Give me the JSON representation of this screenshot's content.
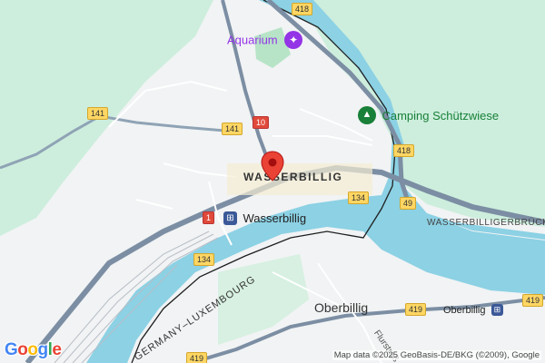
{
  "map": {
    "colors": {
      "land": "#f1f3f4",
      "forest": "#cdeedd",
      "water": "#8cd1e4",
      "border": "#1f1f1f",
      "highway": "#7c8ea3",
      "road": "#ffffff",
      "poi": "#9334e6",
      "park": "#188038",
      "transit": "#3b5998"
    },
    "places": {
      "wasserbillig": "WASSERBILLIG",
      "oberbillig": "Oberbillig",
      "wasserbilliger_bruck": "WASSERBILLIGERBRÜCK",
      "flurstr": "Flurstraß"
    },
    "pois": {
      "aquarium": "Aquarium",
      "camping": "Camping Schützwiese",
      "station_wasserbillig": "Wasserbillig",
      "station_oberbillig": "Oberbillig"
    },
    "border_label": "GERMANY–LUXEMBOURG",
    "route_shields": {
      "r418_top": "418",
      "r141_left": "141",
      "r141_mid": "141",
      "r10": "10",
      "r418_mid": "418",
      "r134": "134",
      "r49": "49",
      "r1": "1",
      "r134_low": "134",
      "r419_mid": "419",
      "r419_right": "419",
      "r419_low": "419"
    },
    "icons": {
      "pin": "location-pin-icon",
      "aquarium": "aquarium-icon",
      "camping": "camping-icon",
      "train": "train-station-icon"
    },
    "attribution": "Map data ©2025 GeoBasis-DE/BKG (©2009), Google",
    "logo": "Google"
  }
}
